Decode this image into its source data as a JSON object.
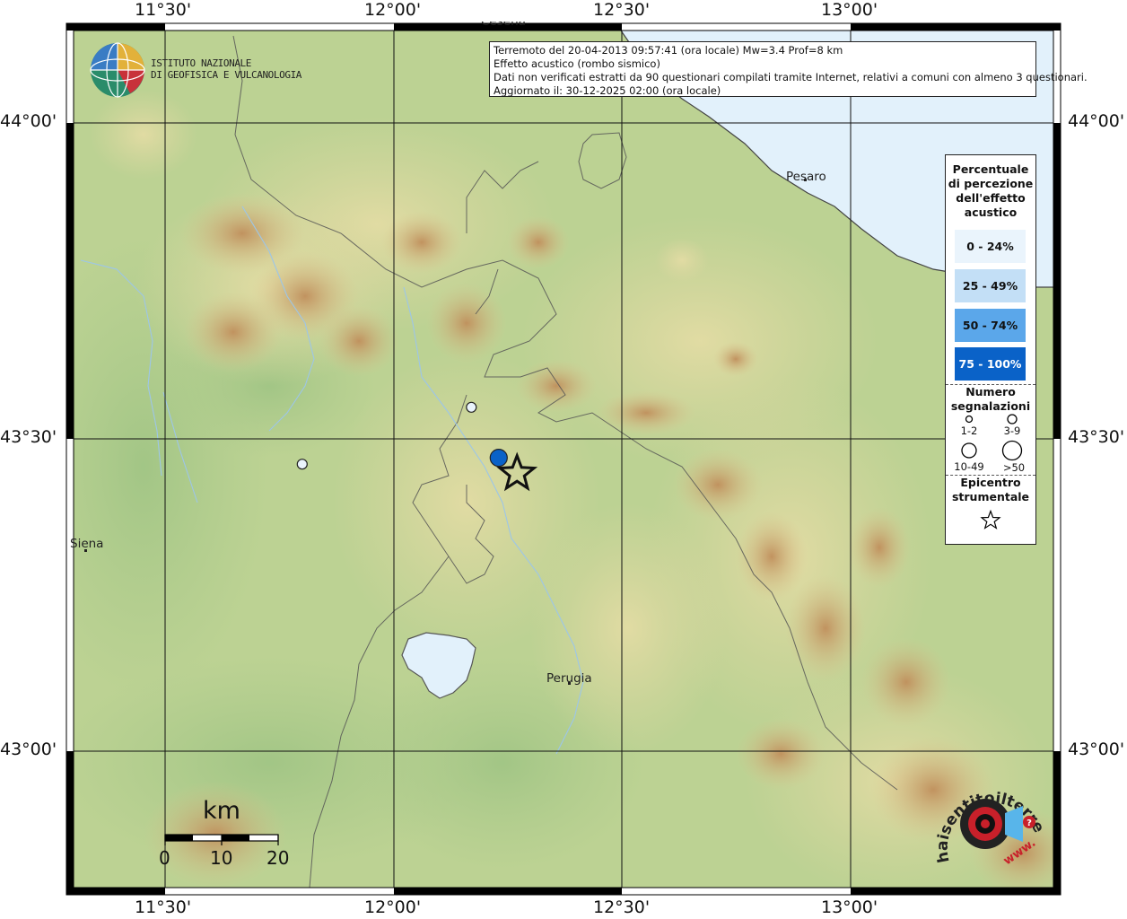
{
  "header": {
    "lines": [
      "Terremoto del 20-04-2013 09:57:41 (ora locale) Mw=3.4 Prof=8 km",
      "Effetto acustico (rombo sismico)",
      "Dati non verificati estratti da 90 questionari compilati tramite Internet, relativi a comuni con almeno 3 questionari.",
      "Aggiornato il: 30-12-2025 02:00 (ora locale)"
    ]
  },
  "institute": {
    "line1": "ISTITUTO NAZIONALE",
    "line2": "DI GEOFISICA E VULCANOLOGIA"
  },
  "axes": {
    "lon_labels": [
      "11°30'",
      "12°00'",
      "12°30'",
      "13°00'"
    ],
    "lat_labels": [
      "44°00'",
      "43°30'",
      "43°00'"
    ]
  },
  "legend": {
    "title_lines": [
      "Percentuale",
      "di percezione",
      "dell'effetto",
      "acustico"
    ],
    "classes": [
      {
        "label": "0 - 24%",
        "color": "#eaf4fc"
      },
      {
        "label": "25 - 49%",
        "color": "#c3dff6"
      },
      {
        "label": "50 - 74%",
        "color": "#5ba7ea"
      },
      {
        "label": "75 - 100%",
        "color": "#0a62c8"
      }
    ],
    "count_title_lines": [
      "Numero",
      "segnalazioni"
    ],
    "counts": [
      "1-2",
      "3-9",
      "10-49",
      ">50"
    ],
    "epicenter_lines": [
      "Epicentro",
      "strumentale"
    ]
  },
  "cities": [
    {
      "name": "Pesaro"
    },
    {
      "name": "Siena"
    },
    {
      "name": "Perugia"
    },
    {
      "name": "Cesena"
    }
  ],
  "observations": [
    {
      "lon": 11.8,
      "lat": 43.46,
      "class": "0 - 24%",
      "count": "1-2"
    },
    {
      "lon": 12.17,
      "lat": 43.55,
      "class": "0 - 24%",
      "count": "1-2"
    },
    {
      "lon": 12.23,
      "lat": 43.47,
      "class": "75 - 100%",
      "count": "3-9"
    }
  ],
  "epicenter": {
    "lon": 12.27,
    "lat": 43.445
  },
  "scale": {
    "unit": "km",
    "ticks": [
      "0",
      "10",
      "20"
    ]
  },
  "logo": {
    "text": "haisentitoilterremoto.it",
    "prefix": "www."
  },
  "colors": {
    "sea": "#e2f1fb",
    "lowland": "#b5cf8f",
    "hills": "#d8d49a",
    "mountains": "#c9a06a",
    "star": "#111111"
  }
}
